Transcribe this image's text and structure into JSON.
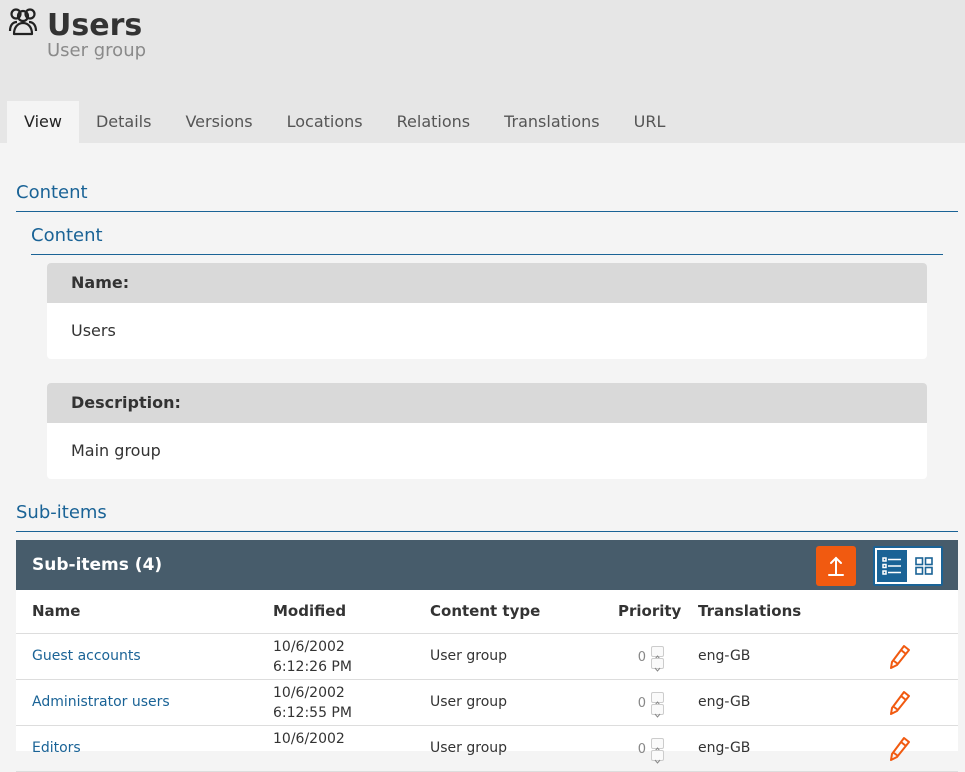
{
  "header": {
    "title": "Users",
    "subtitle": "User group",
    "icon": "users-icon"
  },
  "tabs": [
    {
      "label": "View",
      "active": true
    },
    {
      "label": "Details"
    },
    {
      "label": "Versions"
    },
    {
      "label": "Locations"
    },
    {
      "label": "Relations"
    },
    {
      "label": "Translations"
    },
    {
      "label": "URL"
    }
  ],
  "content": {
    "section_title": "Content",
    "group_title": "Content",
    "fields": [
      {
        "label": "Name:",
        "value": "Users"
      },
      {
        "label": "Description:",
        "value": "Main group"
      }
    ]
  },
  "subitems": {
    "section_title": "Sub-items",
    "panel_title": "Sub-items (4)",
    "columns": [
      "Name",
      "Modified",
      "Content type",
      "Priority",
      "Translations"
    ],
    "rows": [
      {
        "name": "Guest accounts",
        "date": "10/6/2002",
        "time": "6:12:26 PM",
        "type": "User group",
        "priority": "0",
        "translations": "eng-GB"
      },
      {
        "name": "Administrator users",
        "date": "10/6/2002",
        "time": "6:12:55 PM",
        "type": "User group",
        "priority": "0",
        "translations": "eng-GB"
      },
      {
        "name": "Editors",
        "date": "10/6/2002",
        "time": "",
        "type": "User group",
        "priority": "0",
        "translations": "eng-GB"
      }
    ]
  },
  "colors": {
    "accent": "#1a6396",
    "orange": "#f15a10",
    "panel_header": "#475c6b"
  }
}
